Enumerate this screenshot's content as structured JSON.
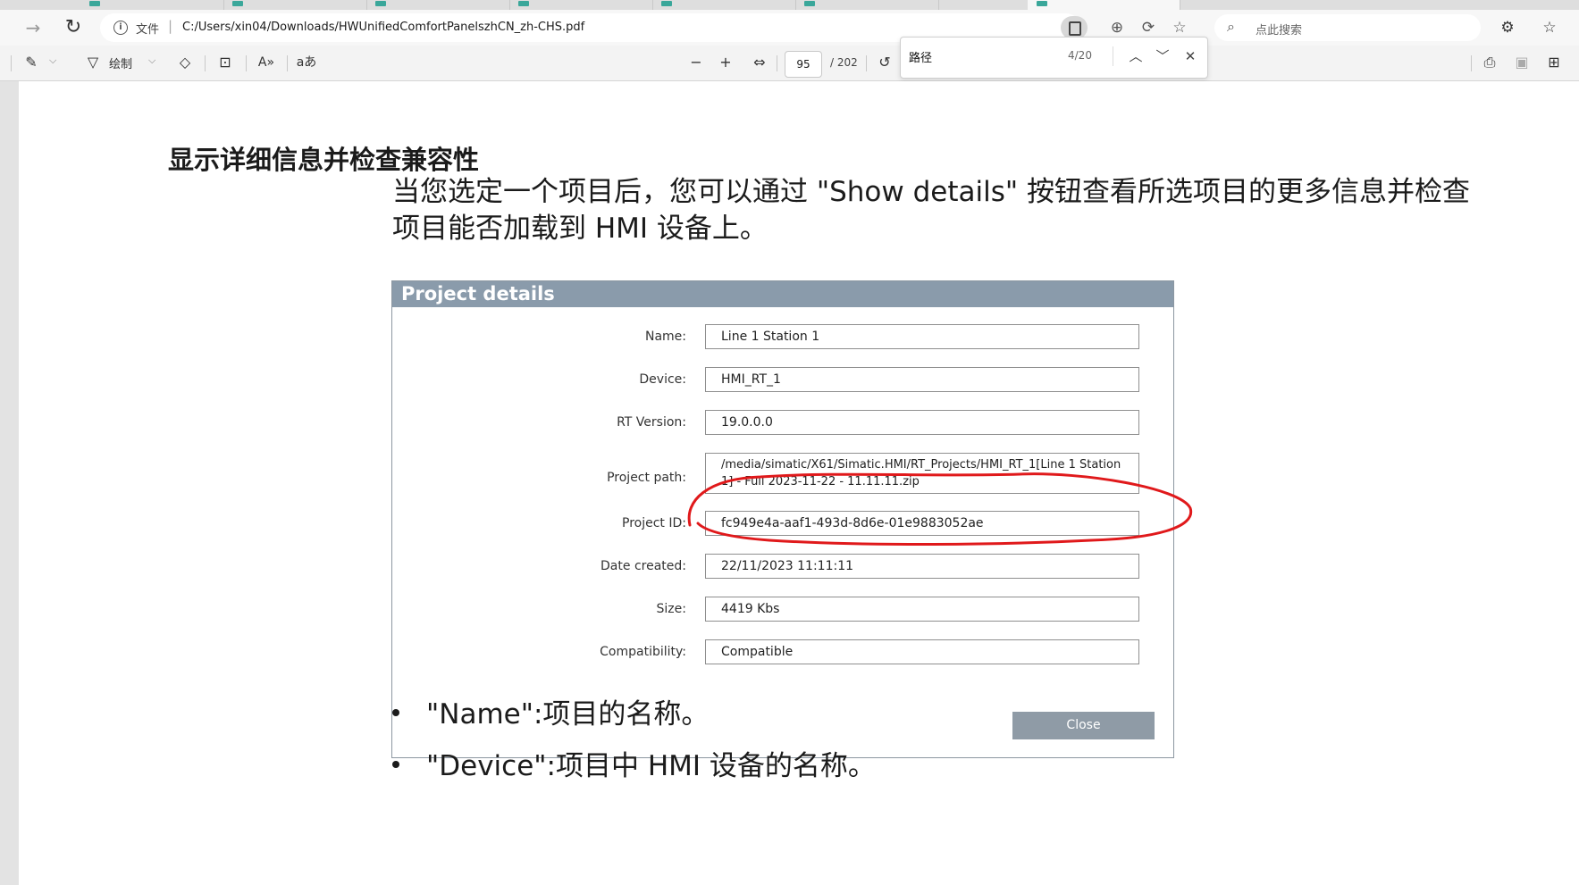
{
  "browser": {
    "url_scheme_label": "文件",
    "url": "C:/Users/xin04/Downloads/HWUnifiedComfortPanelszhCN_zh-CHS.pdf",
    "search_placeholder": "点此搜索"
  },
  "pdf_toolbar": {
    "draw_label": "绘制",
    "page_current": "95",
    "page_total": "/ 202",
    "find_query": "路径",
    "find_count": "4/20"
  },
  "document": {
    "heading": "显示详细信息并检查兼容性",
    "paragraph": "当您选定一个项目后，您可以通过 \"Show details\" 按钮查看所选项目的更多信息并检查项目能否加载到 HMI 设备上。",
    "dialog": {
      "title": "Project details",
      "fields": [
        {
          "label": "Name:",
          "value": "Line 1 Station 1"
        },
        {
          "label": "Device:",
          "value": "HMI_RT_1"
        },
        {
          "label": "RT Version:",
          "value": "19.0.0.0"
        },
        {
          "label": "Project path:",
          "value": "/media/simatic/X61/Simatic.HMI/RT_Projects/HMI_RT_1[Line 1 Station 1] - Full 2023-11-22 - 11.11.11.zip"
        },
        {
          "label": "Project ID:",
          "value": "fc949e4a-aaf1-493d-8d6e-01e9883052ae"
        },
        {
          "label": "Date created:",
          "value": "22/11/2023 11:11:11"
        },
        {
          "label": "Size:",
          "value": "4419 Kbs"
        },
        {
          "label": "Compatibility:",
          "value": "Compatible"
        }
      ],
      "close_label": "Close"
    },
    "bullets": [
      "\"Name\":项目的名称。",
      "\"Device\":项目中 HMI 设备的名称。"
    ]
  },
  "colors": {
    "dialog_title_bg": "#8a9bab",
    "close_button_bg": "#8f9ba6",
    "annotation_red": "#e0191b",
    "tab_accent": "#3aa79a"
  },
  "icons": [
    "info-icon",
    "back-arrow-icon",
    "forward-arrow-icon",
    "reload-icon",
    "read-aloud-icon",
    "zoom-icon",
    "refresh-icon",
    "favorite-star-icon",
    "search-icon",
    "extensions-icon",
    "favorites-icon",
    "highlight-icon",
    "draw-icon",
    "eraser-icon",
    "text-box-icon",
    "read-aloud-text-icon",
    "translate-icon",
    "zoom-out-icon",
    "zoom-in-icon",
    "fit-page-icon",
    "rotate-icon",
    "find-prev-icon",
    "find-next-icon",
    "find-close-icon",
    "print-icon",
    "save-icon",
    "save-as-icon"
  ]
}
